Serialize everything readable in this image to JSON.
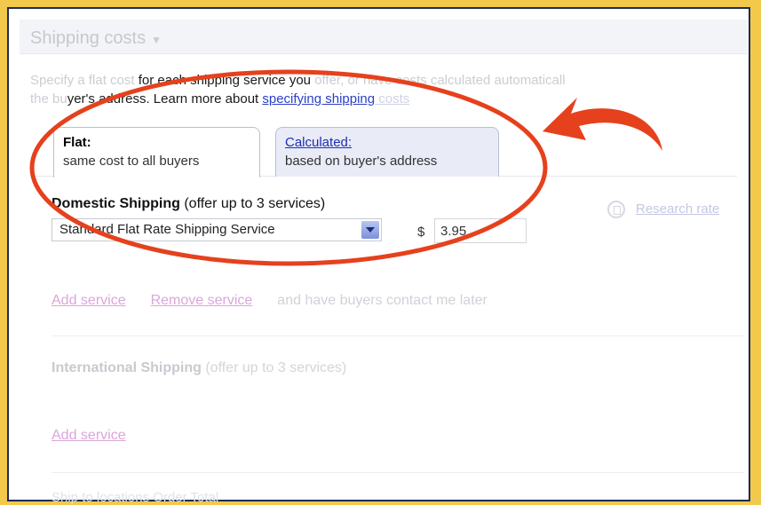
{
  "section": {
    "title": "Shipping costs",
    "toggle_glyph": "▼"
  },
  "intro": {
    "line1_faint": "Specify a flat cost",
    "line1_dark": " for each shipping service you ",
    "line1_tail": "offer, or have costs calculated automaticall",
    "line2_faint_start": "the bu",
    "line2_dark": "yer's address. Learn more about ",
    "link_visible": "specifying shipping",
    "link_faint": " costs"
  },
  "tabs": [
    {
      "title": "Flat:",
      "subtitle": "same cost to all buyers"
    },
    {
      "title": "Calculated:",
      "subtitle": "based on buyer's address"
    }
  ],
  "domestic": {
    "heading": "Domestic Shipping",
    "note": " (offer up to 3 services)"
  },
  "service_select": {
    "value": "Standard Flat Rate Shipping Service"
  },
  "price": {
    "currency": "$",
    "value": "3.95"
  },
  "research": {
    "link": "Research rate"
  },
  "service_actions": {
    "add": "Add service",
    "remove": "Remove service",
    "contact": "and have buyers contact me later"
  },
  "international": {
    "heading": "International Shipping",
    "note": " (offer up to 3 services)",
    "add": "Add service"
  },
  "bottom_cut_text": "Ship to locations        Order Total",
  "colors": {
    "annotation_red": "#e5411d",
    "border_yellow": "#f2c94a",
    "link_blue": "#2b3fc6"
  }
}
